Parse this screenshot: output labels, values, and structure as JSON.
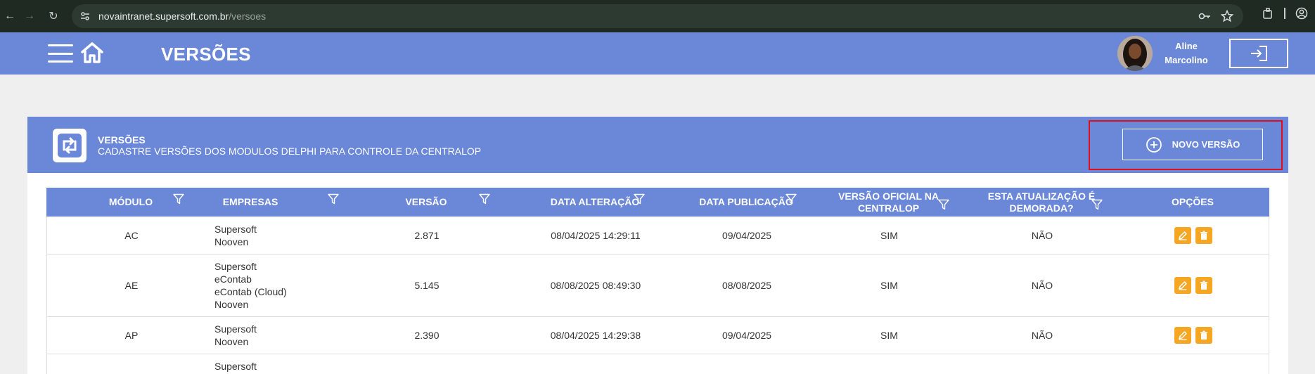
{
  "browser": {
    "url_host": "novaintranet.supersoft.com.br",
    "url_path": "/versoes"
  },
  "header": {
    "title": "VERSÕES",
    "user_first": "Aline",
    "user_last": "Marcolino"
  },
  "card": {
    "title": "VERSÕES",
    "subtitle": "CADASTRE VERSÕES DOS MODULOS DELPHI PARA CONTROLE DA CENTRALOP",
    "new_button_label": "NOVO VERSÃO"
  },
  "table": {
    "headers": [
      "MÓDULO",
      "EMPRESAS",
      "VERSÃO",
      "DATA ALTERAÇÃO",
      "DATA PUBLICAÇÃO",
      "VERSÃO OFICIAL NA CENTRALOP",
      "ESTA ATUALIZAÇÃO É DEMORADA?",
      "OPÇÕES"
    ],
    "rows": [
      {
        "modulo": "AC",
        "empresas": [
          "Supersoft",
          "Nooven"
        ],
        "versao": "2.871",
        "data_alteracao": "08/04/2025 14:29:11",
        "data_publicacao": "09/04/2025",
        "oficial": "SIM",
        "demorada": "NÃO"
      },
      {
        "modulo": "AE",
        "empresas": [
          "Supersoft",
          "eContab",
          "eContab (Cloud)",
          "Nooven"
        ],
        "versao": "5.145",
        "data_alteracao": "08/08/2025 08:49:30",
        "data_publicacao": "08/08/2025",
        "oficial": "SIM",
        "demorada": "NÃO"
      },
      {
        "modulo": "AP",
        "empresas": [
          "Supersoft",
          "Nooven"
        ],
        "versao": "2.390",
        "data_alteracao": "08/04/2025 14:29:38",
        "data_publicacao": "09/04/2025",
        "oficial": "SIM",
        "demorada": "NÃO"
      },
      {
        "modulo": "",
        "empresas": [
          "Supersoft"
        ],
        "versao": "",
        "data_alteracao": "",
        "data_publicacao": "",
        "oficial": "",
        "demorada": ""
      }
    ]
  },
  "colors": {
    "header_blue": "#6a87d8",
    "action_orange": "#f5a623",
    "highlight_red": "#e0101b"
  }
}
